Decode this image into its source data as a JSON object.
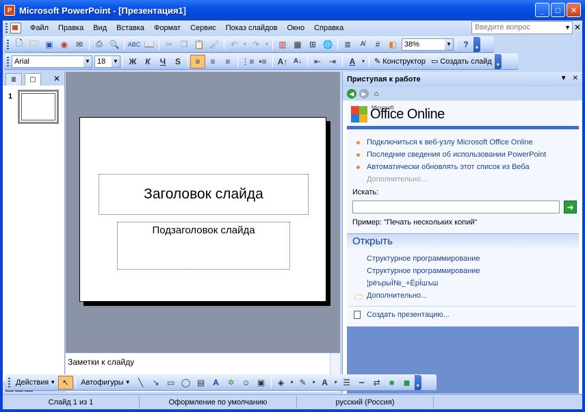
{
  "window": {
    "title": "Microsoft PowerPoint - [Презентация1]",
    "minimize_glyph": "_",
    "maximize_glyph": "□",
    "close_glyph": "✕"
  },
  "menu": {
    "items": [
      "Файл",
      "Правка",
      "Вид",
      "Вставка",
      "Формат",
      "Сервис",
      "Показ слайдов",
      "Окно",
      "Справка"
    ],
    "help_placeholder": "Введите вопрос"
  },
  "standard_toolbar": {
    "zoom": "38%"
  },
  "format_toolbar": {
    "font": "Arial",
    "size": "18",
    "bold": "Ж",
    "italic": "К",
    "underline": "Ч",
    "shadow": "S",
    "designer": "Конструктор",
    "new_slide": "Создать слайд"
  },
  "left_pane": {
    "slide_number": "1"
  },
  "slide": {
    "title_placeholder": "Заголовок слайда",
    "subtitle_placeholder": "Подзаголовок слайда"
  },
  "notes": {
    "placeholder": "Заметки к слайду"
  },
  "task_pane": {
    "title": "Приступая к работе",
    "logo_small": "Microsoft",
    "logo_text": "Office Online",
    "links": [
      "Подключиться к веб-узлу Microsoft Office Online",
      "Последние сведения об использовании PowerPoint",
      "Автоматически обновлять этот список из Веба"
    ],
    "more_link": "Дополнительно...",
    "search_label": "Искать:",
    "search_example": "Пример:  \"Печать нескольких копий\"",
    "open_section": "Открыть",
    "open_items": [
      "Структурное программирование",
      "Структурное программирование",
      "¦рёърыЇ№_+ЁрЇшъш"
    ],
    "open_more": "Дополнительно...",
    "create": "Создать презентацию..."
  },
  "drawing_toolbar": {
    "actions": "Действия",
    "autoshapes": "Автофигуры"
  },
  "status_bar": {
    "slide": "Слайд 1 из 1",
    "design": "Оформление по умолчанию",
    "language": "русский (Россия)"
  },
  "colors": {
    "titlebar": "#0a54e6",
    "toolbar": "#c4d8f5",
    "accent_link": "#1a3e9c",
    "bullet": "#f08a24"
  }
}
